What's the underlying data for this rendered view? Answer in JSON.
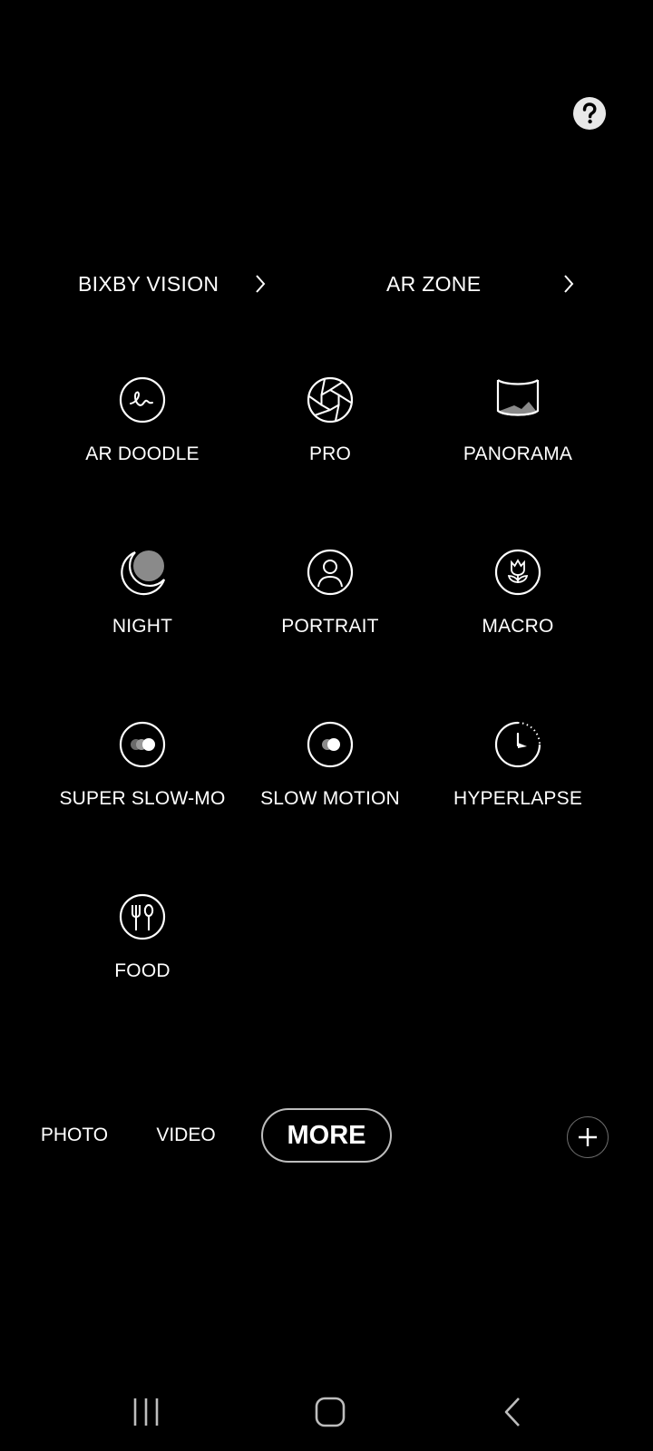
{
  "top": {
    "help_icon": "question-mark-icon"
  },
  "shortcuts": [
    {
      "label": "BIXBY VISION",
      "icon": "chevron-right-icon"
    },
    {
      "label": "AR ZONE",
      "icon": "chevron-right-icon"
    }
  ],
  "modes": [
    {
      "label": "AR DOODLE",
      "icon": "ar-doodle-icon"
    },
    {
      "label": "PRO",
      "icon": "aperture-icon"
    },
    {
      "label": "PANORAMA",
      "icon": "panorama-icon"
    },
    {
      "label": "NIGHT",
      "icon": "moon-icon"
    },
    {
      "label": "PORTRAIT",
      "icon": "person-icon"
    },
    {
      "label": "MACRO",
      "icon": "flower-icon"
    },
    {
      "label": "SUPER SLOW-MO",
      "icon": "super-slow-mo-icon"
    },
    {
      "label": "SLOW MOTION",
      "icon": "slow-motion-icon"
    },
    {
      "label": "HYPERLAPSE",
      "icon": "hyperlapse-clock-icon"
    },
    {
      "label": "FOOD",
      "icon": "fork-spoon-icon"
    }
  ],
  "tabs": [
    {
      "label": "PHOTO",
      "active": false
    },
    {
      "label": "VIDEO",
      "active": false
    },
    {
      "label": "MORE",
      "active": true
    }
  ],
  "add_button_icon": "plus-icon",
  "nav": {
    "recents": "recents-icon",
    "home": "home-icon",
    "back": "back-icon"
  },
  "colors": {
    "background": "#000000",
    "text": "#ffffff",
    "active_tab_border": "#bdbdbd"
  }
}
